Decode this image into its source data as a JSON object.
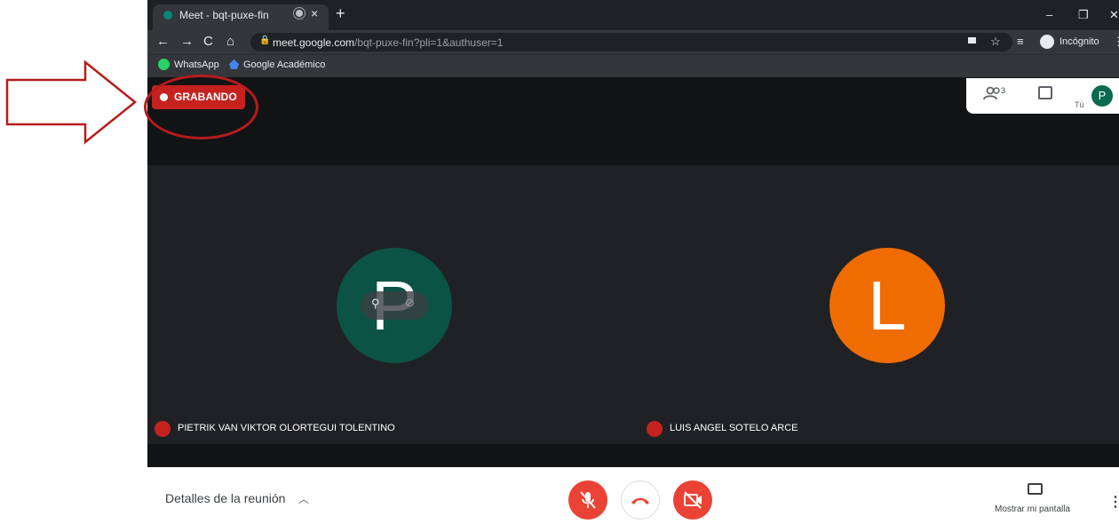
{
  "browser": {
    "tab_title": "Meet - bqt-puxe-fin",
    "tab_close": "×",
    "new_tab": "+",
    "win_min": "–",
    "win_restore": "❐",
    "win_close": "✕",
    "url_host": "meet.google.com",
    "url_path": "/bqt-puxe-fin?pli=1&authuser=1",
    "profile_label": "Incógnito",
    "bookmarks": [
      "WhatsApp",
      "Google Académico"
    ]
  },
  "meet": {
    "recording_label": "GRABANDO",
    "participants_count": "3",
    "self_label": "Tú",
    "self_initial": "P",
    "participants": [
      {
        "initial": "P",
        "name": "PIETRIK VAN VIKTOR OLORTEGUI TOLENTINO",
        "color": "#0b5345"
      },
      {
        "initial": "L",
        "name": "LUIS ANGEL SOTELO ARCE",
        "color": "#ef6c00"
      }
    ],
    "details_label": "Detalles de la reunión",
    "present_label": "Mostrar mi pantalla"
  },
  "colors": {
    "recording_red": "#c5221f",
    "control_red": "#ea4335",
    "annotation_red": "#b71c1c"
  }
}
